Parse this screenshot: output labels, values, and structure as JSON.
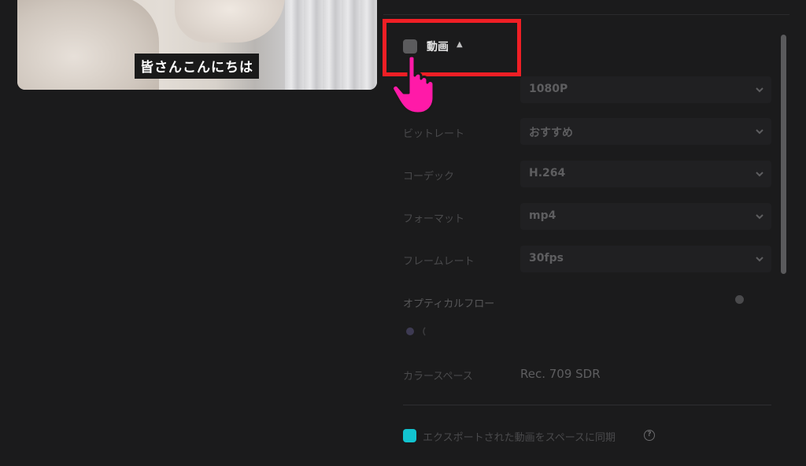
{
  "preview": {
    "subtitle": "皆さんこんにちは"
  },
  "video_section": {
    "title": "動画",
    "checked": false
  },
  "settings": [
    {
      "label": "",
      "value": "1080P"
    },
    {
      "label": "ビットレート",
      "value": "おすすめ"
    },
    {
      "label": "コーデック",
      "value": "H.264"
    },
    {
      "label": "フォーマット",
      "value": "mp4"
    },
    {
      "label": "フレームレート",
      "value": "30fps"
    }
  ],
  "optical_flow": {
    "label": "オプティカルフロー"
  },
  "color_space": {
    "label": "カラースペース",
    "value": "Rec. 709 SDR"
  },
  "sync": {
    "label": "エクスポートされた動画をスペースに同期",
    "checked": true
  },
  "colors": {
    "accent": "#12c3cf",
    "highlight": "#f01f25",
    "cursor": "#ff1aa8"
  },
  "icons": {
    "cursor": "hand-pointer-icon",
    "help": "question-circle-icon",
    "select": "chevron-down-icon"
  }
}
